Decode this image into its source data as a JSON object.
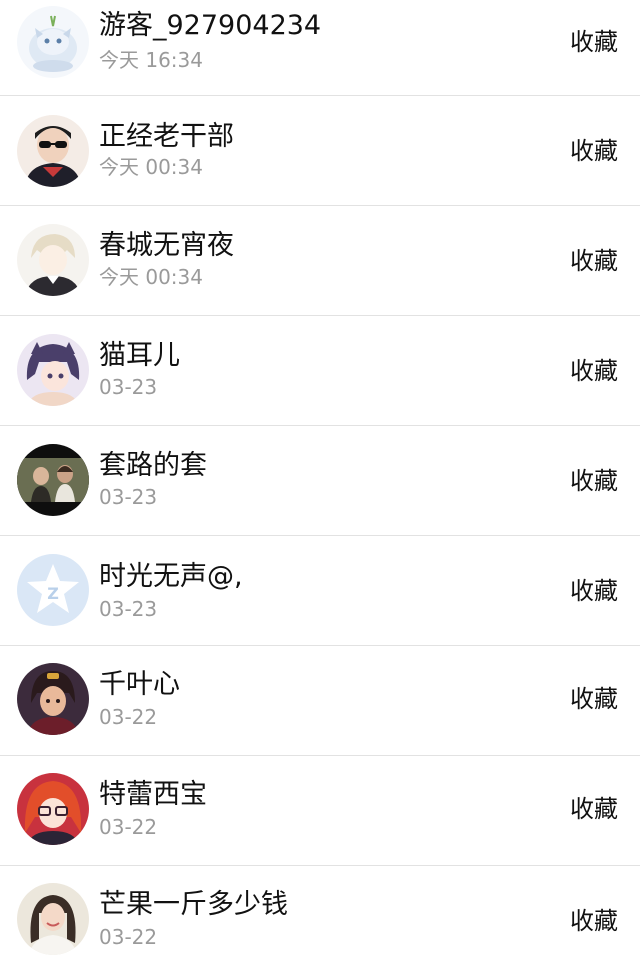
{
  "rows": [
    {
      "name": "游客_927904234",
      "time": "今天 16:34",
      "action": "收藏",
      "avatar_icon": "cartoon-dragon-avatar-icon",
      "avatar_bg": "#dfe9f4"
    },
    {
      "name": "正经老干部",
      "time": "今天 00:34",
      "action": "收藏",
      "avatar_icon": "person-sunglasses-avatar-icon",
      "avatar_bg": "#f2dcd0"
    },
    {
      "name": "春城无宵夜",
      "time": "今天 00:34",
      "action": "收藏",
      "avatar_icon": "anime-boy-avatar-icon",
      "avatar_bg": "#ece8e2"
    },
    {
      "name": "猫耳儿",
      "time": "03-23",
      "action": "收藏",
      "avatar_icon": "anime-girl-avatar-icon",
      "avatar_bg": "#d9cfe4"
    },
    {
      "name": "套路的套",
      "time": "03-23",
      "action": "收藏",
      "avatar_icon": "movie-still-avatar-icon",
      "avatar_bg": "#5a6048"
    },
    {
      "name": "时光无声@,",
      "time": "03-23",
      "action": "收藏",
      "avatar_icon": "default-star-avatar-icon",
      "avatar_bg": "#d9e7f6"
    },
    {
      "name": "千叶心",
      "time": "03-22",
      "action": "收藏",
      "avatar_icon": "game-character-avatar-icon",
      "avatar_bg": "#3b2a3a"
    },
    {
      "name": "特蕾西宝",
      "time": "03-22",
      "action": "收藏",
      "avatar_icon": "red-hair-anime-avatar-icon",
      "avatar_bg": "#c8323e"
    },
    {
      "name": "芒果一斤多少钱",
      "time": "03-22",
      "action": "收藏",
      "avatar_icon": "woman-portrait-avatar-icon",
      "avatar_bg": "#e8e2d6"
    }
  ]
}
